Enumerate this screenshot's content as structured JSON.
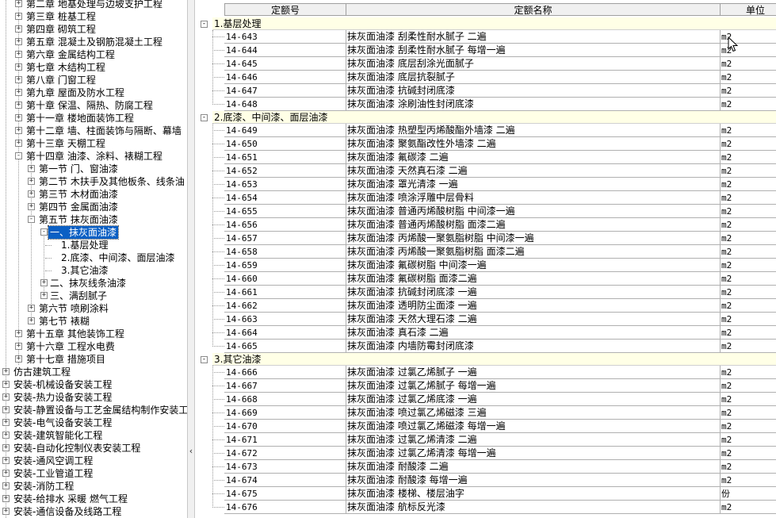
{
  "tree": {
    "items": [
      {
        "label": "第二章  地基处理与边坡支护工程",
        "toggle": "+",
        "level": 2
      },
      {
        "label": "第三章  桩基工程",
        "toggle": "+",
        "level": 2
      },
      {
        "label": "第四章  砌筑工程",
        "toggle": "+",
        "level": 2
      },
      {
        "label": "第五章  混凝土及钢筋混凝土工程",
        "toggle": "+",
        "level": 2
      },
      {
        "label": "第六章  金属结构工程",
        "toggle": "+",
        "level": 2
      },
      {
        "label": "第七章  木结构工程",
        "toggle": "+",
        "level": 2
      },
      {
        "label": "第八章  门窗工程",
        "toggle": "+",
        "level": 2
      },
      {
        "label": "第九章  屋面及防水工程",
        "toggle": "+",
        "level": 2
      },
      {
        "label": "第十章  保温、隔热、防腐工程",
        "toggle": "+",
        "level": 2
      },
      {
        "label": "第十一章  楼地面装饰工程",
        "toggle": "+",
        "level": 2
      },
      {
        "label": "第十二章  墙、柱面装饰与隔断、幕墙",
        "toggle": "+",
        "level": 2
      },
      {
        "label": "第十三章  天棚工程",
        "toggle": "+",
        "level": 2
      },
      {
        "label": "第十四章  油漆、涂料、裱糊工程",
        "toggle": "-",
        "level": 2
      },
      {
        "label": "第一节  门、窗油漆",
        "toggle": "+",
        "level": 3
      },
      {
        "label": "第二节  木扶手及其他板条、线条油",
        "toggle": "+",
        "level": 3
      },
      {
        "label": "第三节  木材面油漆",
        "toggle": "+",
        "level": 3
      },
      {
        "label": "第四节  金属面油漆",
        "toggle": "+",
        "level": 3
      },
      {
        "label": "第五节  抹灰面油漆",
        "toggle": "-",
        "level": 3
      },
      {
        "label": "一、抹灰面油漆",
        "toggle": "-",
        "level": 4,
        "selected": true
      },
      {
        "label": "1.基层处理",
        "toggle": "",
        "level": 5
      },
      {
        "label": "2.底漆、中间漆、面层油漆",
        "toggle": "",
        "level": 5
      },
      {
        "label": "3.其它油漆",
        "toggle": "",
        "level": 5
      },
      {
        "label": "二、抹灰线条油漆",
        "toggle": "+",
        "level": 4
      },
      {
        "label": "三、满刮腻子",
        "toggle": "+",
        "level": 4
      },
      {
        "label": "第六节  喷刷涂料",
        "toggle": "+",
        "level": 3
      },
      {
        "label": "第七节  裱糊",
        "toggle": "+",
        "level": 3
      },
      {
        "label": "第十五章  其他装饰工程",
        "toggle": "+",
        "level": 2
      },
      {
        "label": "第十六章  工程水电费",
        "toggle": "+",
        "level": 2
      },
      {
        "label": "第十七章  措施项目",
        "toggle": "+",
        "level": 2
      },
      {
        "label": "仿古建筑工程",
        "toggle": "+",
        "level": 1
      },
      {
        "label": "安装-机械设备安装工程",
        "toggle": "+",
        "level": 1
      },
      {
        "label": "安装-热力设备安装工程",
        "toggle": "+",
        "level": 1
      },
      {
        "label": "安装-静置设备与工艺金属结构制作安装工",
        "toggle": "+",
        "level": 1
      },
      {
        "label": "安装-电气设备安装工程",
        "toggle": "+",
        "level": 1
      },
      {
        "label": "安装-建筑智能化工程",
        "toggle": "+",
        "level": 1
      },
      {
        "label": "安装-自动化控制仪表安装工程",
        "toggle": "+",
        "level": 1
      },
      {
        "label": "安装-通风空调工程",
        "toggle": "+",
        "level": 1
      },
      {
        "label": "安装-工业管道工程",
        "toggle": "+",
        "level": 1
      },
      {
        "label": "安装-消防工程",
        "toggle": "+",
        "level": 1
      },
      {
        "label": "安装-给排水 采暖 燃气工程",
        "toggle": "+",
        "level": 1
      },
      {
        "label": "安装-通信设备及线路工程",
        "toggle": "+",
        "level": 1
      }
    ]
  },
  "splitter": {
    "arrow": "‹"
  },
  "grid": {
    "headers": {
      "code": "定额号",
      "name": "定额名称",
      "unit": "单位"
    },
    "groups": [
      {
        "toggle": "-",
        "label": "1.基层处理",
        "rows": [
          {
            "code": "14-643",
            "name": "抹灰面油漆 刮柔性耐水腻子 二遍",
            "unit": "m2"
          },
          {
            "code": "14-644",
            "name": "抹灰面油漆 刮柔性耐水腻子 每增一遍",
            "unit": "m2"
          },
          {
            "code": "14-645",
            "name": "抹灰面油漆 底层刮涂光面腻子",
            "unit": "m2"
          },
          {
            "code": "14-646",
            "name": "抹灰面油漆 底层抗裂腻子",
            "unit": "m2"
          },
          {
            "code": "14-647",
            "name": "抹灰面油漆 抗碱封闭底漆",
            "unit": "m2"
          },
          {
            "code": "14-648",
            "name": "抹灰面油漆 涂刷油性封闭底漆",
            "unit": "m2"
          }
        ]
      },
      {
        "toggle": "-",
        "label": "2.底漆、中间漆、面层油漆",
        "rows": [
          {
            "code": "14-649",
            "name": "抹灰面油漆 热塑型丙烯酸酯外墙漆 二遍",
            "unit": "m2"
          },
          {
            "code": "14-650",
            "name": "抹灰面油漆 聚氨酯改性外墙漆 二遍",
            "unit": "m2"
          },
          {
            "code": "14-651",
            "name": "抹灰面油漆 氟碳漆 二遍",
            "unit": "m2"
          },
          {
            "code": "14-652",
            "name": "抹灰面油漆 天然真石漆 二遍",
            "unit": "m2"
          },
          {
            "code": "14-653",
            "name": "抹灰面油漆 罩光清漆 一遍",
            "unit": "m2"
          },
          {
            "code": "14-654",
            "name": "抹灰面油漆 喷涂浮雕中层骨料",
            "unit": "m2"
          },
          {
            "code": "14-655",
            "name": "抹灰面油漆 普通丙烯酸树脂 中间漆一遍",
            "unit": "m2"
          },
          {
            "code": "14-656",
            "name": "抹灰面油漆 普通丙烯酸树脂 面漆二遍",
            "unit": "m2"
          },
          {
            "code": "14-657",
            "name": "抹灰面油漆 丙烯酸一聚氨脂树脂 中间漆一遍",
            "unit": "m2"
          },
          {
            "code": "14-658",
            "name": "抹灰面油漆 丙烯酸一聚氨脂树脂 面漆二遍",
            "unit": "m2"
          },
          {
            "code": "14-659",
            "name": "抹灰面油漆 氟碳树脂 中间漆一遍",
            "unit": "m2"
          },
          {
            "code": "14-660",
            "name": "抹灰面油漆 氟碳树脂 面漆二遍",
            "unit": "m2"
          },
          {
            "code": "14-661",
            "name": "抹灰面油漆 抗碱封闭底漆 一遍",
            "unit": "m2"
          },
          {
            "code": "14-662",
            "name": "抹灰面油漆 透明防尘面漆 一遍",
            "unit": "m2"
          },
          {
            "code": "14-663",
            "name": "抹灰面油漆 天然大理石漆 二遍",
            "unit": "m2"
          },
          {
            "code": "14-664",
            "name": "抹灰面油漆 真石漆 二遍",
            "unit": "m2"
          },
          {
            "code": "14-665",
            "name": "抹灰面油漆 内墙防霉封闭底漆",
            "unit": "m2"
          }
        ]
      },
      {
        "toggle": "-",
        "label": "3.其它油漆",
        "rows": [
          {
            "code": "14-666",
            "name": "抹灰面油漆 过氯乙烯腻子 一遍",
            "unit": "m2"
          },
          {
            "code": "14-667",
            "name": "抹灰面油漆 过氯乙烯腻子 每增一遍",
            "unit": "m2"
          },
          {
            "code": "14-668",
            "name": "抹灰面油漆 过氯乙烯底漆 一遍",
            "unit": "m2"
          },
          {
            "code": "14-669",
            "name": "抹灰面油漆 喷过氯乙烯磁漆 三遍",
            "unit": "m2"
          },
          {
            "code": "14-670",
            "name": "抹灰面油漆 喷过氯乙烯磁漆 每增一遍",
            "unit": "m2"
          },
          {
            "code": "14-671",
            "name": "抹灰面油漆 过氯乙烯清漆 二遍",
            "unit": "m2"
          },
          {
            "code": "14-672",
            "name": "抹灰面油漆 过氯乙烯清漆 每增一遍",
            "unit": "m2"
          },
          {
            "code": "14-673",
            "name": "抹灰面油漆 耐酸漆 二遍",
            "unit": "m2"
          },
          {
            "code": "14-674",
            "name": "抹灰面油漆 耐酸漆 每增一遍",
            "unit": "m2"
          },
          {
            "code": "14-675",
            "name": "抹灰面油漆 楼梯、楼层油字",
            "unit": "份"
          },
          {
            "code": "14-676",
            "name": "抹灰面油漆 航标反光漆",
            "unit": "m2"
          }
        ]
      }
    ]
  }
}
